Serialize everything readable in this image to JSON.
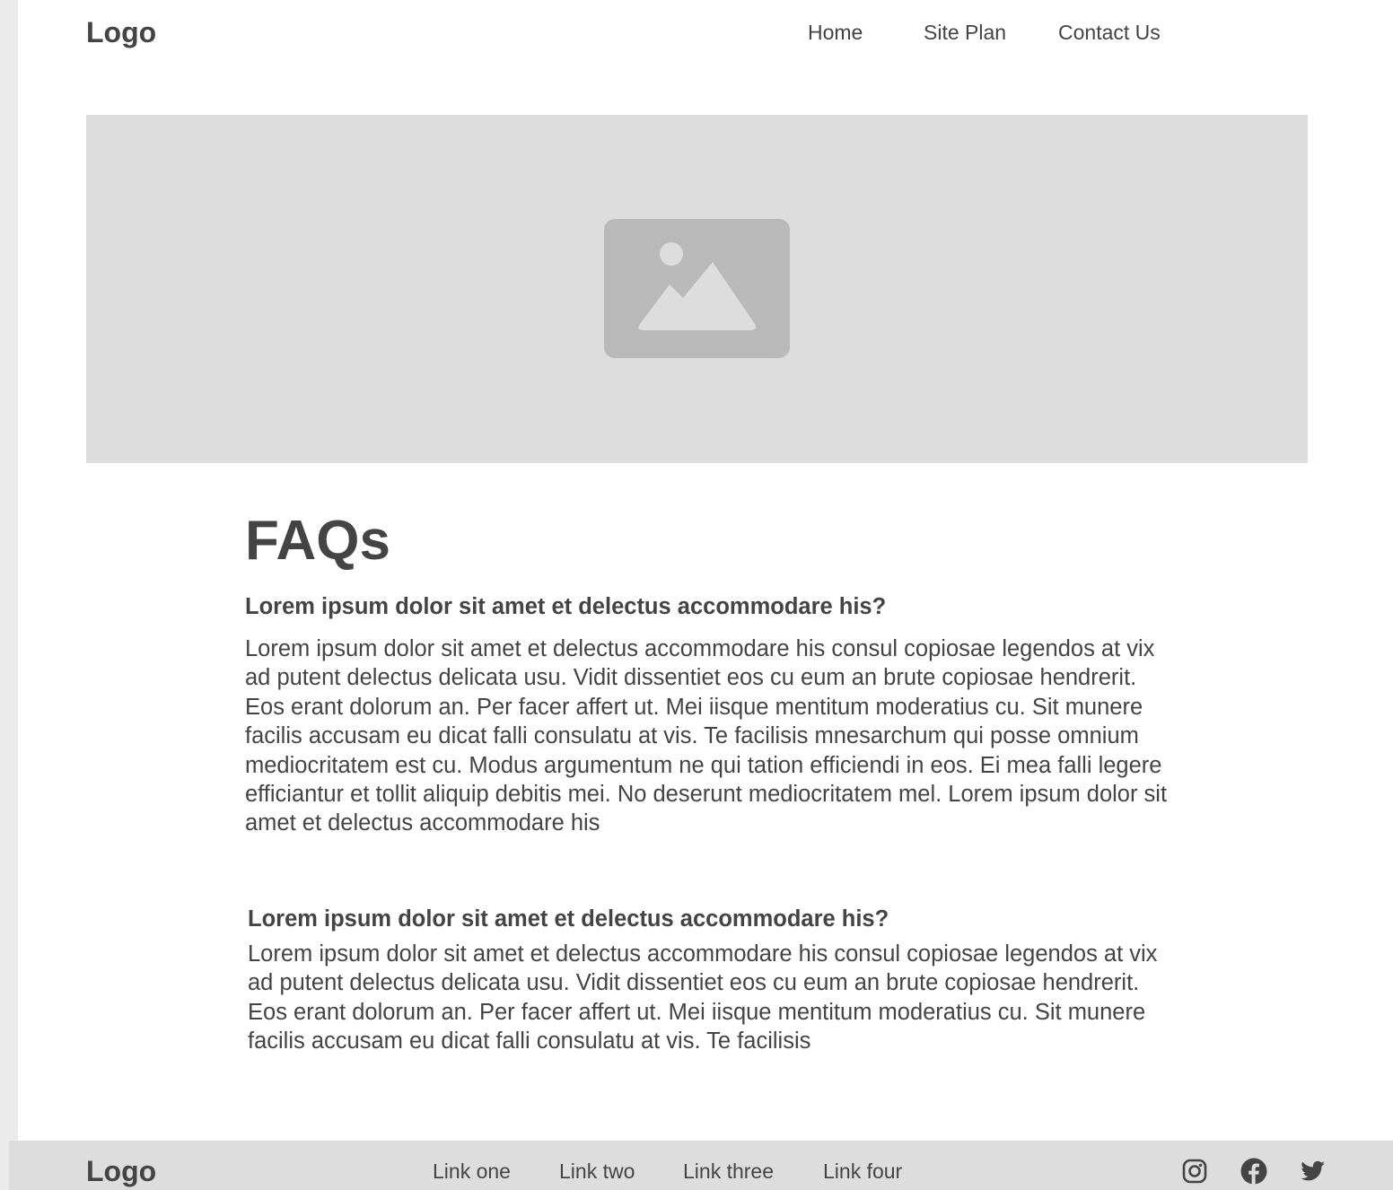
{
  "header": {
    "logo": "Logo",
    "nav": [
      {
        "label": "Home"
      },
      {
        "label": "Site Plan"
      },
      {
        "label": "Contact Us"
      }
    ]
  },
  "hero": {
    "icon": "image-placeholder-icon"
  },
  "main": {
    "title": "FAQs",
    "faqs": [
      {
        "question": "Lorem ipsum dolor sit amet et delectus accommodare his?",
        "answer": "Lorem ipsum dolor sit amet et delectus accommodare his consul copiosae legendos at vix ad putent delectus delicata usu. Vidit dissentiet eos cu eum an brute copiosae hendrerit. Eos erant dolorum an. Per facer affert ut. Mei iisque mentitum moderatius cu. Sit munere facilis accusam eu dicat falli consulatu at vis. Te facilisis mnesarchum qui posse omnium mediocritatem est cu. Modus argumentum ne qui tation efficiendi in eos. Ei mea falli legere efficiantur et tollit aliquip debitis mei. No deserunt mediocritatem mel. Lorem ipsum dolor sit amet et delectus accommodare his"
      },
      {
        "question": "Lorem ipsum dolor sit amet et delectus accommodare his?",
        "answer": "Lorem ipsum dolor sit amet et delectus accommodare his consul copiosae legendos at vix ad putent delectus delicata usu. Vidit dissentiet eos cu eum an brute copiosae hendrerit. Eos erant dolorum an. Per facer affert ut. Mei iisque mentitum moderatius cu. Sit munere facilis accusam eu dicat falli consulatu at vis. Te facilisis"
      }
    ]
  },
  "footer": {
    "logo": "Logo",
    "links": [
      {
        "label": "Link one"
      },
      {
        "label": "Link two"
      },
      {
        "label": "Link three"
      },
      {
        "label": "Link four"
      }
    ],
    "social": [
      "instagram-icon",
      "facebook-icon",
      "twitter-icon"
    ]
  },
  "colors": {
    "text": "#444444",
    "placeholder_bg": "#dddddd",
    "placeholder_icon": "#b9b9b9",
    "page_bg": "#ffffff",
    "outer_bg": "#ebebeb"
  }
}
